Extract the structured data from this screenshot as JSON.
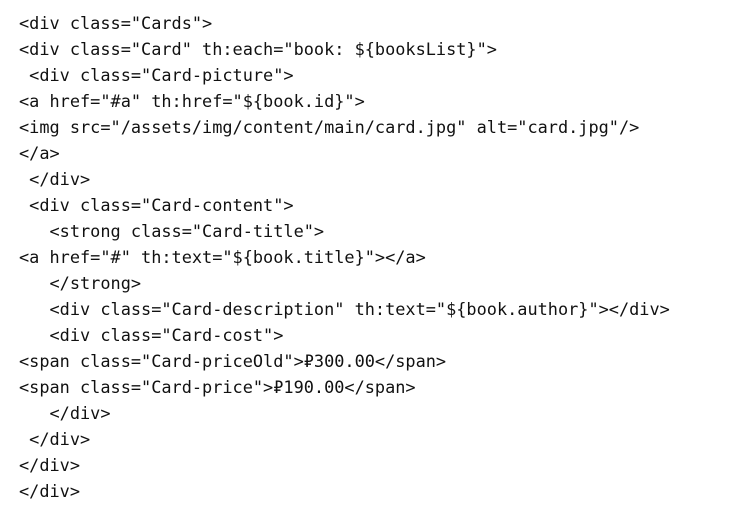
{
  "code": {
    "lines": [
      "<div class=\"Cards\">",
      "<div class=\"Card\" th:each=\"book: ${booksList}\">",
      " <div class=\"Card-picture\">",
      "<a href=\"#a\" th:href=\"${book.id}\">",
      "<img src=\"/assets/img/content/main/card.jpg\" alt=\"card.jpg\"/>",
      "</a>",
      " </div>",
      " <div class=\"Card-content\">",
      "   <strong class=\"Card-title\">",
      "<a href=\"#\" th:text=\"${book.title}\"></a>",
      "   </strong>",
      "   <div class=\"Card-description\" th:text=\"${book.author}\"></div>",
      "   <div class=\"Card-cost\">",
      "<span class=\"Card-priceOld\">₽300.00</span>",
      "<span class=\"Card-price\">₽190.00</span>",
      "   </div>",
      " </div>",
      "</div>",
      "</div>"
    ]
  }
}
